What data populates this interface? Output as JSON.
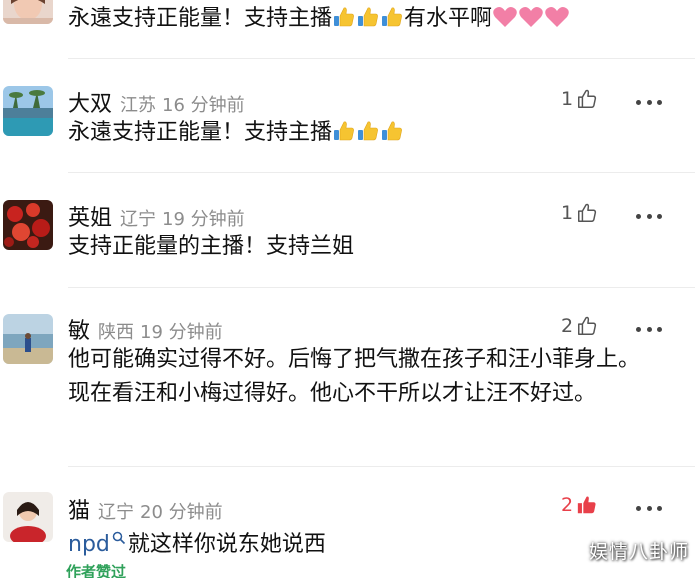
{
  "comments": [
    {
      "text_prefix": "永遠支持正能量！支持主播",
      "text_suffix": "有水平啊",
      "emoji": [
        "thumbs-up",
        "thumbs-up",
        "thumbs-up"
      ],
      "trailing_emoji": [
        "pink-heart",
        "pink-heart",
        "pink-heart"
      ]
    },
    {
      "name": "大双",
      "location": "江苏",
      "time": "16 分钟前",
      "likes": "1",
      "text_prefix": "永遠支持正能量！支持主播",
      "emoji": [
        "thumbs-up",
        "thumbs-up",
        "thumbs-up"
      ]
    },
    {
      "name": "英姐",
      "location": "辽宁",
      "time": "19 分钟前",
      "likes": "1",
      "text": "支持正能量的主播！支持兰姐"
    },
    {
      "name": "敏",
      "location": "陕西",
      "time": "19 分钟前",
      "likes": "2",
      "text": "他可能确实过得不好。后悔了把气撒在孩子和汪小菲身上。现在看汪和小梅过得好。他心不干所以才让汪不好过。"
    },
    {
      "name": "猫",
      "location": "辽宁",
      "time": "20 分钟前",
      "likes": "2",
      "mention": "npd",
      "text": "就这样你说东她说西",
      "author_badge": "作者赞过"
    }
  ],
  "watermark": "娱情八卦师",
  "colors": {
    "accent_red": "#e8404a",
    "meta_gray": "#8c8c8c",
    "author_green": "#2fa15a",
    "mention_blue": "#2b5c9c"
  },
  "icons": [
    "thumbs-up-outline-icon",
    "thumbs-up-filled-icon",
    "more-dots-icon",
    "search-icon"
  ]
}
